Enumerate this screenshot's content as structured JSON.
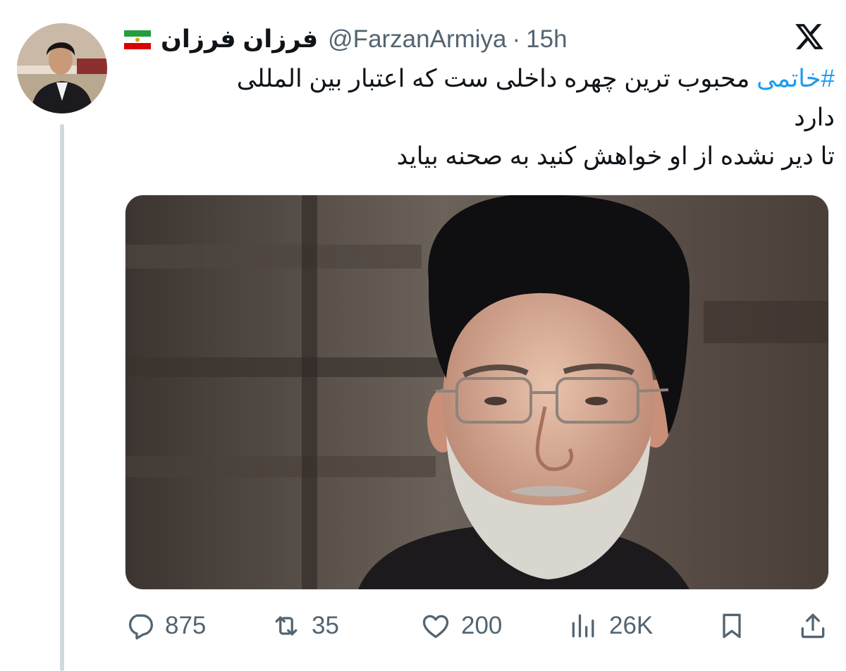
{
  "tweet": {
    "author": {
      "display_name": "فرزان فرزان",
      "handle": "@FarzanArmiya",
      "time": "15h",
      "separator": "·",
      "flag_icon": "iran-lion-and-sun-flag-icon",
      "avatar": "profile-photo"
    },
    "text": {
      "hashtag": "#خاتمی",
      "line1_rest": " محبوب ترین چهره داخلی ست که اعتبار بین المللی",
      "line2": "دارد",
      "line3": "تا دیر نشده از او خواهش کنید به صحنه بیاید"
    },
    "media": {
      "kind": "photo",
      "icon": "photo-of-cleric"
    },
    "actions": {
      "replies": "875",
      "reposts": "35",
      "likes": "200",
      "views": "26K"
    },
    "icons": [
      "x-logo-icon",
      "reply-icon",
      "repost-icon",
      "like-icon",
      "views-icon",
      "bookmark-icon",
      "share-icon"
    ],
    "colors": {
      "link": "#1d9bf0",
      "secondary": "#536471",
      "text": "#0f1419"
    }
  }
}
